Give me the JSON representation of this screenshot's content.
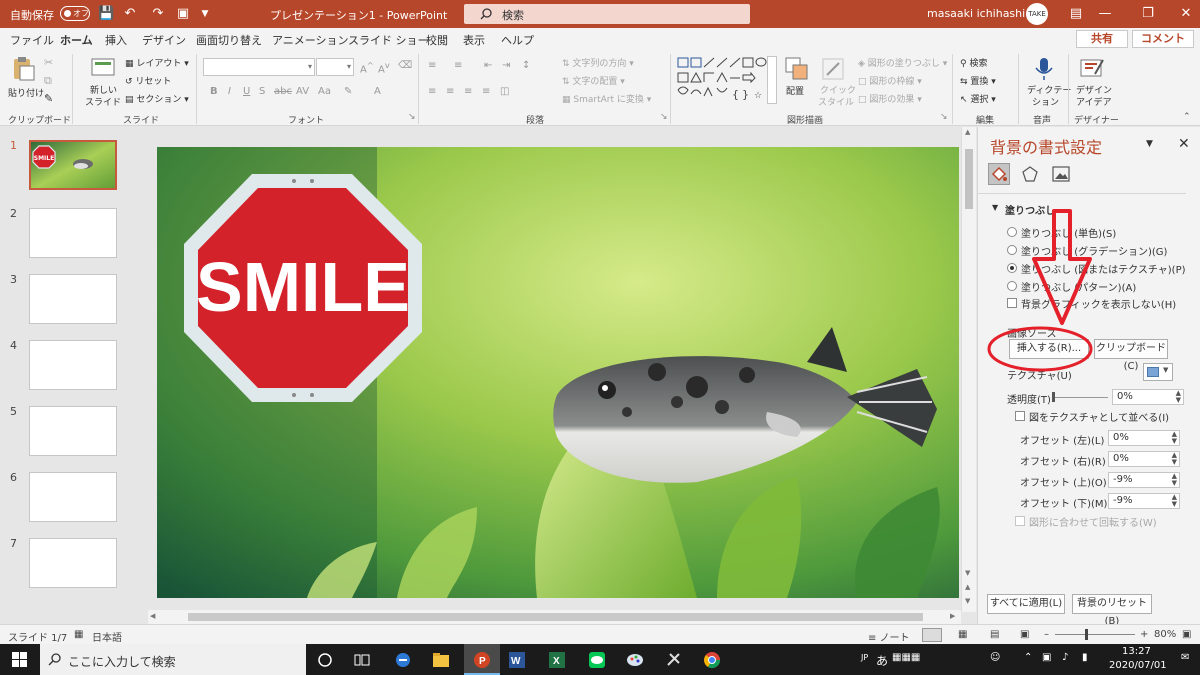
{
  "titlebar": {
    "autosave_label": "自動保存",
    "autosave_state": "オフ",
    "doc_title": "プレゼンテーション1 - PowerPoint",
    "search_placeholder": "検索",
    "user_name": "masaaki ichihashi",
    "avatar_text": "TAKE"
  },
  "tabs": [
    "ファイル",
    "ホーム",
    "挿入",
    "デザイン",
    "画面切り替え",
    "アニメーション",
    "スライド ショー",
    "校閲",
    "表示",
    "ヘルプ"
  ],
  "share_label": "共有",
  "comment_label": "コメント",
  "ribbon": {
    "clipboard": {
      "paste": "貼り付け",
      "group": "クリップボード"
    },
    "slides": {
      "new_slide_1": "新しい",
      "new_slide_2": "スライド",
      "layout": "レイアウト",
      "reset": "リセット",
      "section": "セクション",
      "group": "スライド"
    },
    "font": {
      "group": "フォント"
    },
    "paragraph": {
      "text_direction": "文字列の方向",
      "align_text": "文字の配置",
      "smartart": "SmartArt に変換",
      "group": "段落"
    },
    "drawing": {
      "arrange": "配置",
      "quick_styles_1": "クイック",
      "quick_styles_2": "スタイル",
      "shape_fill": "図形の塗りつぶし",
      "shape_outline": "図形の枠線",
      "shape_effects": "図形の効果",
      "group": "図形描画"
    },
    "editing": {
      "find": "検索",
      "replace": "置換",
      "select": "選択",
      "group": "編集"
    },
    "voice": {
      "dictate_1": "ディクテー",
      "dictate_2": "ション",
      "group": "音声"
    },
    "designer": {
      "ideas_1": "デザイン",
      "ideas_2": "アイデア",
      "group": "デザイナー"
    }
  },
  "thumbnails": [
    "1",
    "2",
    "3",
    "4",
    "5",
    "6",
    "7"
  ],
  "slide": {
    "sign_text": "SMILE"
  },
  "pane": {
    "title": "背景の書式設定",
    "section": "塗りつぶし",
    "fill_options": [
      "塗りつぶし (単色)(S)",
      "塗りつぶし (グラデーション)(G)",
      "塗りつぶし (図またはテクスチャ)(P)",
      "塗りつぶし (パターン)(A)"
    ],
    "hide_graphics": "背景グラフィックを表示しない(H)",
    "image_source": "画像ソース",
    "insert_btn": "挿入する(R)...",
    "clipboard_btn": "クリップボード(C)",
    "texture": "テクスチャ(U)",
    "transparency_label": "透明度(T)",
    "transparency_value": "0%",
    "tile": "図をテクスチャとして並べる(I)",
    "offsets": [
      {
        "label": "オフセット (左)(L)",
        "value": "0%"
      },
      {
        "label": "オフセット (右)(R)",
        "value": "0%"
      },
      {
        "label": "オフセット (上)(O)",
        "value": "-9%"
      },
      {
        "label": "オフセット (下)(M)",
        "value": "-9%"
      }
    ],
    "rotate": "図形に合わせて回転する(W)",
    "apply_all": "すべてに適用(L)",
    "reset_bg": "背景のリセット(B)"
  },
  "status": {
    "slide_count": "スライド 1/7",
    "language": "日本語",
    "notes": "ノート",
    "zoom": "80%"
  },
  "taskbar": {
    "search_placeholder": "ここに入力して検索",
    "ime_mode": "あ",
    "time": "13:27",
    "date": "2020/07/01",
    "ime_lang": "JP"
  }
}
